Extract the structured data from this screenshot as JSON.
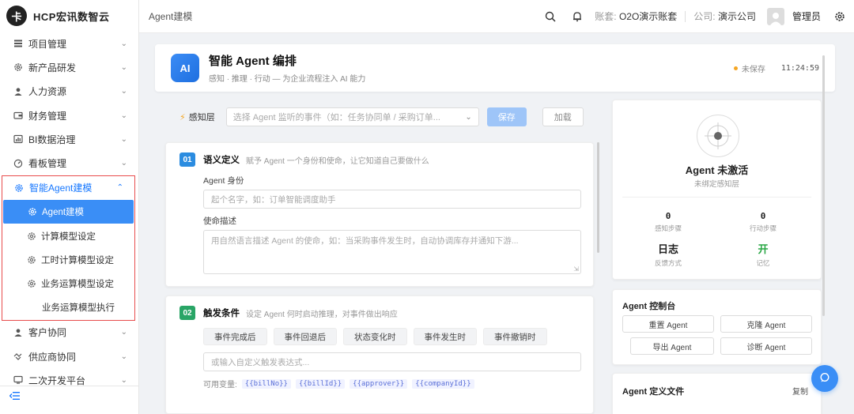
{
  "brand": {
    "logo_text": "卡",
    "name": "HCP宏讯数智云"
  },
  "sidebar": {
    "items": [
      {
        "label": "项目管理",
        "icon": "list-icon"
      },
      {
        "label": "新产品研发",
        "icon": "gear-icon"
      },
      {
        "label": "人力资源",
        "icon": "user-icon"
      },
      {
        "label": "财务管理",
        "icon": "wallet-icon"
      },
      {
        "label": "BI数据治理",
        "icon": "chart-icon"
      },
      {
        "label": "看板管理",
        "icon": "gauge-icon"
      }
    ],
    "agent_group": {
      "label": "智能Agent建模",
      "children": [
        {
          "label": "Agent建模",
          "active": true
        },
        {
          "label": "计算模型设定"
        },
        {
          "label": "工时计算模型设定"
        },
        {
          "label": "业务运算模型设定"
        },
        {
          "label": "业务运算模型执行"
        }
      ]
    },
    "items_after": [
      {
        "label": "客户协同",
        "icon": "user-icon"
      },
      {
        "label": "供应商协同",
        "icon": "handshake-icon"
      },
      {
        "label": "二次开发平台",
        "icon": "monitor-icon"
      }
    ]
  },
  "header": {
    "breadcrumb": "Agent建模",
    "account_label": "账套:",
    "account_value": "O2O演示账套",
    "company_label": "公司:",
    "company_value": "演示公司",
    "user_name": "管理员"
  },
  "title_card": {
    "badge": "AI",
    "title": "智能 Agent 编排",
    "subtitle": "感知 · 推理 · 行动 — 为企业流程注入 AI 能力",
    "save_status": "未保存",
    "time": "11:24:59"
  },
  "sense": {
    "label": "感知层",
    "placeholder": "选择 Agent 监听的事件（如：任务协同单 / 采购订单...",
    "save_label": "保存",
    "load_label": "加载"
  },
  "step1": {
    "num": "01",
    "title": "语义定义",
    "desc": "赋予 Agent 一个身份和使命，让它知道自己要做什么",
    "identity_label": "Agent 身份",
    "identity_placeholder": "起个名字，如：订单智能调度助手",
    "mission_label": "使命描述",
    "mission_placeholder": "用自然语言描述 Agent 的使命，如：当采购事件发生时，自动协调库存并通知下游..."
  },
  "step2": {
    "num": "02",
    "title": "触发条件",
    "desc": "设定 Agent 何时启动推理，对事件做出响应",
    "chips": [
      "事件完成后",
      "事件回退后",
      "状态变化时",
      "事件发生时",
      "事件撤销时"
    ],
    "expr_placeholder": "或输入自定义触发表达式...",
    "vars_label": "可用变量:",
    "vars": [
      "{{billNo}}",
      "{{billId}}",
      "{{approver}}",
      "{{companyId}}"
    ]
  },
  "status": {
    "title": "Agent 未激活",
    "subtitle": "未绑定感知层",
    "stats": [
      {
        "value": "0",
        "key": "感知步骤"
      },
      {
        "value": "0",
        "key": "行动步骤"
      },
      {
        "value": "日志",
        "key": "反馈方式"
      },
      {
        "value": "开",
        "key": "记忆"
      }
    ]
  },
  "console": {
    "title": "Agent 控制台",
    "buttons": [
      "重置 Agent",
      "克隆 Agent",
      "导出 Agent",
      "诊断 Agent"
    ]
  },
  "definition": {
    "title": "Agent 定义文件",
    "copy_label": "复制"
  },
  "colors": {
    "accent": "#3a8ef6",
    "step1": "#2b8ce0",
    "step2": "#29a566",
    "highlight_border": "#e84c4c",
    "enabled_green": "#29a745"
  }
}
